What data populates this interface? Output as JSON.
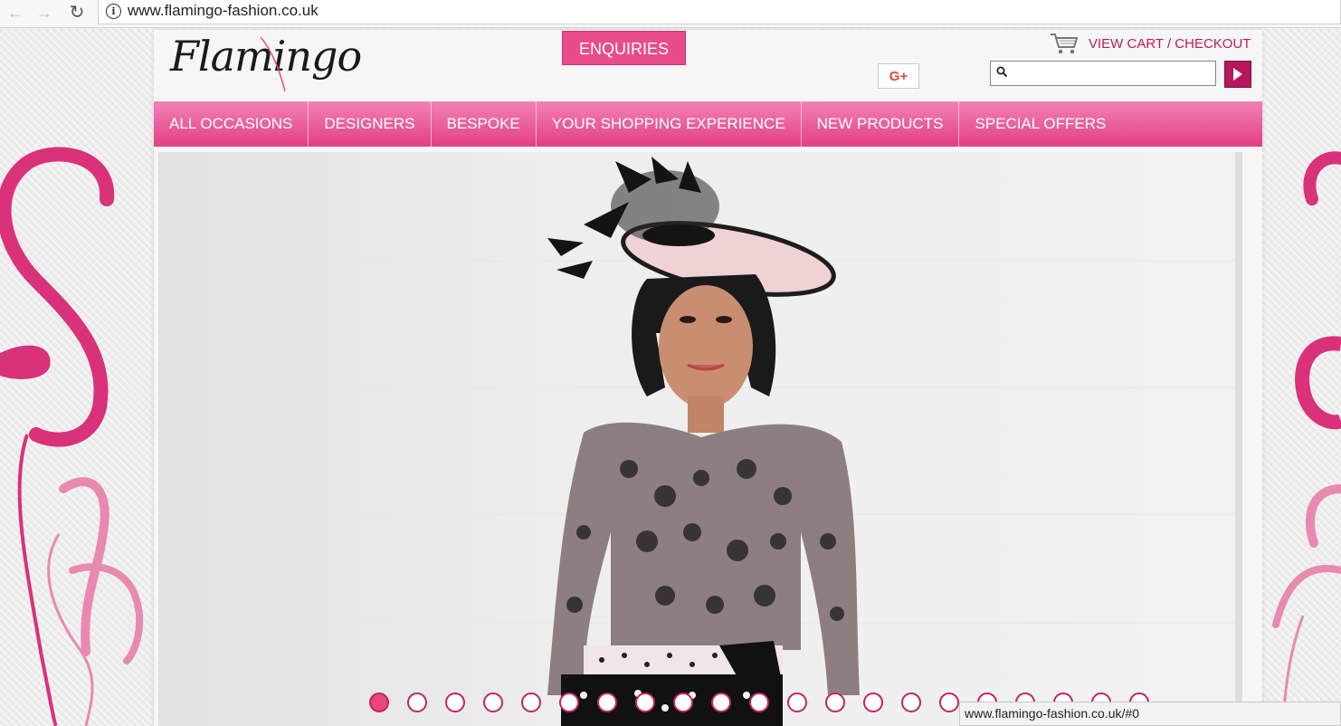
{
  "browser": {
    "url": "www.flamingo-fashion.co.uk",
    "status_url": "www.flamingo-fashion.co.uk/#0"
  },
  "header": {
    "logo_text": "Flamingo",
    "enquiries_label": "ENQUIRIES",
    "gplus_label": "G+",
    "cart_label": "VIEW CART / CHECKOUT",
    "search_value": ""
  },
  "menu": {
    "items": [
      {
        "label": "ALL OCCASIONS"
      },
      {
        "label": "DESIGNERS"
      },
      {
        "label": "BESPOKE"
      },
      {
        "label": "YOUR SHOPPING EXPERIENCE"
      },
      {
        "label": "NEW PRODUCTS"
      },
      {
        "label": "SPECIAL OFFERS"
      }
    ]
  },
  "slider": {
    "total_dots": 21,
    "active_index": 0
  },
  "colors": {
    "brand_pink": "#e84c8a",
    "link_pink": "#c2185b",
    "dark_pink": "#b5165c"
  },
  "icons": {
    "back": "arrow-left-icon",
    "forward": "arrow-right-icon",
    "reload": "reload-icon",
    "info": "info-icon",
    "cart": "cart-icon",
    "search": "search-icon",
    "submit": "play-arrow-icon"
  }
}
